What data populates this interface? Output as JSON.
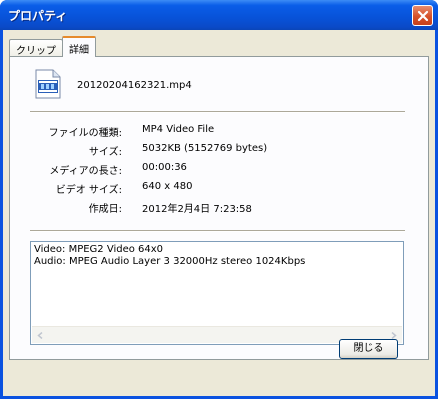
{
  "window": {
    "title": "プロパティ"
  },
  "tabs": [
    {
      "label": "クリップ",
      "active": false
    },
    {
      "label": "詳細",
      "active": true
    }
  ],
  "file": {
    "icon": "video-file-icon",
    "name": "20120204162321.mp4"
  },
  "properties": [
    {
      "label": "ファイルの種類:",
      "value": "MP4 Video File"
    },
    {
      "label": "サイズ:",
      "value": "5032KB (5152769 bytes)"
    },
    {
      "label": "メディアの長さ:",
      "value": "00:00:36"
    },
    {
      "label": "ビデオ サイズ:",
      "value": "640 x 480"
    },
    {
      "label": "作成日:",
      "value": "2012年2月4日  7:23:58"
    }
  ],
  "info": {
    "lines": [
      "Video: MPEG2 Video 64x0",
      "Audio: MPEG Audio Layer 3 32000Hz stereo 1024Kbps"
    ]
  },
  "buttons": {
    "close_label": "閉じる"
  },
  "colors": {
    "titlebar": "#0a52e0",
    "dialog_bg": "#ece9d8",
    "active_tab_accent": "#e68b2c"
  }
}
